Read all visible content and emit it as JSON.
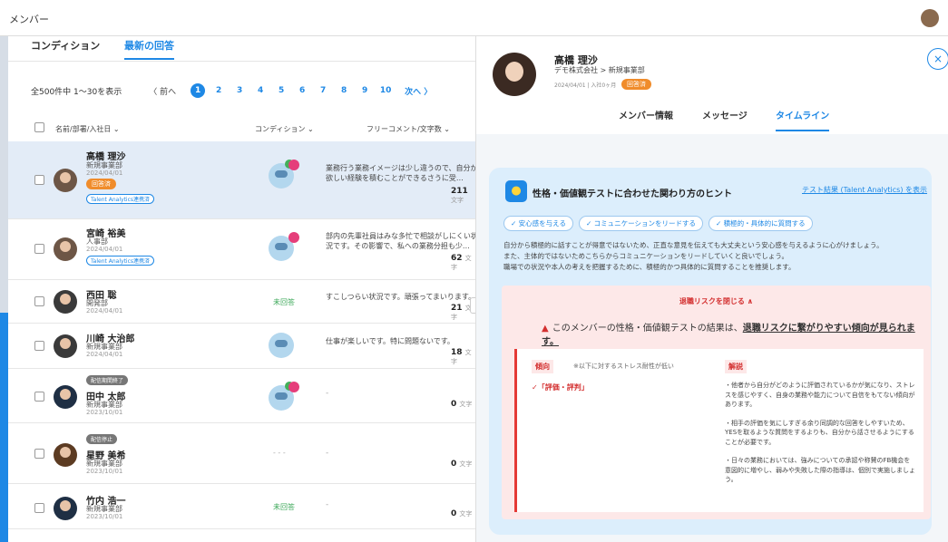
{
  "topbar": {
    "title": "メンバー"
  },
  "tabs": {
    "condition": "コンディション",
    "latest": "最新の回答"
  },
  "pager": {
    "count": "全500件中 1〜30を表示",
    "prev": "〈 前へ",
    "pages": [
      "1",
      "2",
      "3",
      "4",
      "5",
      "6",
      "7",
      "8",
      "9",
      "10"
    ],
    "next": "次へ 〉"
  },
  "table": {
    "col_name": "名前/部署/入社日 ⌄",
    "col_condition": "コンディション ⌄",
    "col_comment": "フリーコメント/文字数 ⌄",
    "chars_unit": "文字"
  },
  "rows": [
    {
      "name": "高橋 理沙",
      "dept": "新規事業部",
      "date": "2024/04/01",
      "badge": "回答済",
      "talent": "Talent Analytics連携済",
      "comment1": "業務行う業務イメージは少し違うので、自分が",
      "comment2": "欲しい経験を積むことができるさうに受…",
      "chars": "211"
    },
    {
      "name": "宮崎 裕美",
      "dept": "人事部",
      "date": "2024/04/01",
      "talent": "Talent Analytics連携済",
      "comment1": "部内の先輩社員はみな多忙で相談がしにくい状",
      "comment2": "況です。その影響で、私への業務分担も少…",
      "chars": "62"
    },
    {
      "name": "西田 聡",
      "dept": "開発部",
      "date": "2024/04/01",
      "cond": "未回答",
      "comment1": "すこしつらい状況です。頑張ってまいります。",
      "chars": "21"
    },
    {
      "name": "川崎 大治郎",
      "dept": "新規事業部",
      "date": "2024/04/01",
      "comment1": "仕事が楽しいです。特に問題ないです。",
      "chars": "18"
    },
    {
      "name": "田中 太郎",
      "dept": "新規事業部",
      "date": "2023/10/01",
      "badge": "配信期間終了",
      "comment1": "-",
      "chars": "0"
    },
    {
      "name": "星野 美希",
      "dept": "新規事業部",
      "date": "2023/10/01",
      "badge": "配信停止",
      "cond": "- - -",
      "comment1": "-",
      "chars": "0"
    },
    {
      "name": "竹内 浩一",
      "dept": "新規事業部",
      "date": "2023/10/01",
      "cond": "未回答",
      "comment1": "-",
      "chars": "0"
    }
  ],
  "panel": {
    "name": "高橋 理沙",
    "dept": "デモ株式会社 > 新規事業部",
    "date": "2024/04/01 | 入社0ヶ月",
    "badge": "回答済",
    "close": "×",
    "tabs": [
      "メンバー情報",
      "メッセージ",
      "タイムライン"
    ],
    "hint": {
      "title": "性格・価値観テストに合わせた関わり方のヒント",
      "link": "テスト結果 (Talent Analytics) を表示",
      "tags": [
        "✓ 安心感を与える",
        "✓ コミュニケーションをリードする",
        "✓ 積極的・具体的に質問する"
      ],
      "desc1": "自分から積極的に話すことが得意ではないため、正直な意見を伝えても大丈夫という安心感を与えるように心がけましょう。",
      "desc2": "また、主体的ではないためこちらからコミュニケーションをリードしていくと良いでしょう。",
      "desc3": "職場での状況や本人の考えを把握するために、積極的かつ具体的に質問することを推奨します。"
    },
    "risk": {
      "toggle": "退職リスクを閉じる ∧",
      "warn_prefix": "このメンバーの性格・価値観テストの結果は、",
      "warn_emph": "退職リスクに繋がりやすい傾向が見られます。",
      "label_tendency": "傾向",
      "tendency_note": "※以下に対するストレス耐性が低い",
      "item": "✓「評価・評判」",
      "label_expl": "解説",
      "expl1": "・他者から自分がどのように評価されているかが気になり、ストレスを感じやすく、自身の業務や能力について自信をもてない傾向があります。",
      "expl2": "・相手の評価を気にしすぎる余り同調的な回答をしやすいため、YESを取るような質問をするよりも、自分から話させるようにすることが必要です。",
      "expl3": "・日々の業務においては、強みについての承認や称賛のFB機会を意図的に増やし、弱みや失敗した際の指導は、個別で実施しましょう。"
    }
  }
}
